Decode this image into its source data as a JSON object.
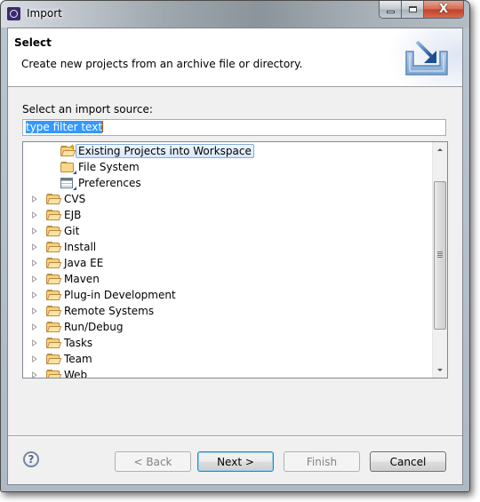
{
  "window": {
    "title": "Import",
    "controls": {
      "minimize": "minimize",
      "maximize": "maximize",
      "close": "X"
    }
  },
  "banner": {
    "title": "Select",
    "description": "Create new projects from an archive file or directory.",
    "icon": "import-tray-icon"
  },
  "source": {
    "label": "Select an import source:",
    "filter_value": "type filter text",
    "filter_placeholder": "type filter text"
  },
  "tree": {
    "children": [
      {
        "label": "Existing Projects into Workspace",
        "icon": "existing-projects-icon",
        "selected": true
      },
      {
        "label": "File System",
        "icon": "folder-icon"
      },
      {
        "label": "Preferences",
        "icon": "preferences-icon"
      }
    ],
    "categories": [
      {
        "label": "CVS"
      },
      {
        "label": "EJB"
      },
      {
        "label": "Git"
      },
      {
        "label": "Install"
      },
      {
        "label": "Java EE"
      },
      {
        "label": "Maven"
      },
      {
        "label": "Plug-in Development"
      },
      {
        "label": "Remote Systems"
      },
      {
        "label": "Run/Debug"
      },
      {
        "label": "Tasks"
      },
      {
        "label": "Team"
      },
      {
        "label": "Web"
      }
    ]
  },
  "footer": {
    "help": "?",
    "back": "< Back",
    "next": "Next >",
    "finish": "Finish",
    "cancel": "Cancel"
  }
}
